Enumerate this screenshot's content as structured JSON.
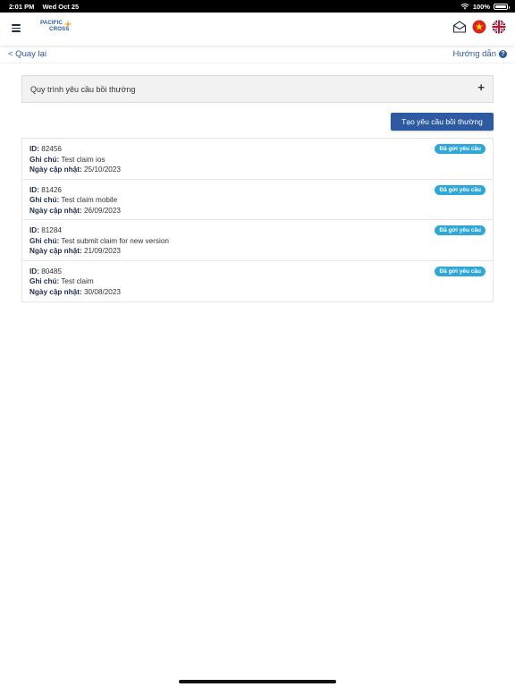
{
  "status_bar": {
    "time": "2:01 PM",
    "date": "Wed Oct 25",
    "battery": "100%"
  },
  "header": {
    "logo_line1": "PACIFIC",
    "logo_line2": "CROSS",
    "icons": [
      "menu-icon",
      "mail-icon",
      "vietnam-flag-icon",
      "uk-flag-icon"
    ],
    "brand_color": "#2d5aa0"
  },
  "nav": {
    "back_label": "< Quay lại",
    "help_label": "Hướng dẫn",
    "help_icon": "?"
  },
  "process": {
    "title": "Quy trình yêu cầu bồi thường",
    "expand_icon": "+"
  },
  "create_button": {
    "label": "Tạo yêu cầu bồi thường"
  },
  "labels": {
    "id": "ID:",
    "note": "Ghi chú:",
    "updated": "Ngày cập nhật:"
  },
  "claims": [
    {
      "id": "82456",
      "note": "Test claim ios",
      "updated": "25/10/2023",
      "status": "Đã gởi yêu cầu"
    },
    {
      "id": "81426",
      "note": "Test claim mobile",
      "updated": "26/09/2023",
      "status": "Đã gởi yêu cầu"
    },
    {
      "id": "81284",
      "note": "Test submit claim for new version",
      "updated": "21/09/2023",
      "status": "Đã gởi yêu cầu"
    },
    {
      "id": "80485",
      "note": "Test claim",
      "updated": "30/08/2023",
      "status": "Đã gởi yêu cầu"
    }
  ],
  "colors": {
    "badge": "#2fa8d8",
    "button": "#2d5aa0",
    "link": "#2d5aa0"
  }
}
